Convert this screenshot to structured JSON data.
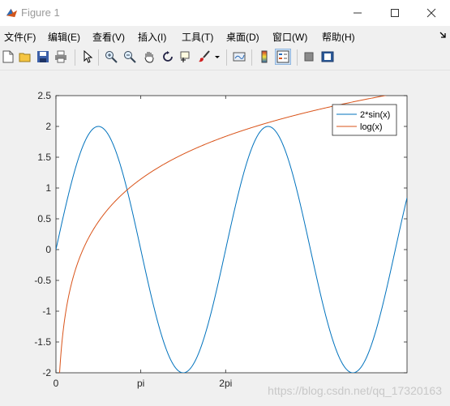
{
  "window": {
    "title": "Figure 1"
  },
  "menu": [
    "文件(F)",
    "编辑(E)",
    "查看(V)",
    "插入(I)",
    "工具(T)",
    "桌面(D)",
    "窗口(W)",
    "帮助(H)"
  ],
  "toolbar": {
    "icons": [
      "new-figure-icon",
      "open-file-icon",
      "save-icon",
      "print-icon",
      "edit-plot-arrow-icon",
      "zoom-in-icon",
      "zoom-out-icon",
      "pan-hand-icon",
      "rotate-3d-icon",
      "data-cursor-icon",
      "brush-icon",
      "brush-dropdown-icon",
      "link-plot-icon",
      "colorbar-icon",
      "legend-icon",
      "hide-plot-tools-icon",
      "show-plot-tools-icon"
    ]
  },
  "chart_data": {
    "type": "line",
    "x_range": [
      0,
      13.0
    ],
    "xticks": [
      {
        "value": 0,
        "label": "0"
      },
      {
        "value": 3.14159,
        "label": "pi"
      },
      {
        "value": 6.28319,
        "label": "2pi"
      }
    ],
    "ylim": [
      -2,
      2.5
    ],
    "yticks": [
      "-2",
      "-1.5",
      "-1",
      "-0.5",
      "0",
      "0.5",
      "1",
      "1.5",
      "2",
      "2.5"
    ],
    "series": [
      {
        "name": "2*sin(x)",
        "expr": "2*sin(x)",
        "color": "#0072bd"
      },
      {
        "name": "log(x)",
        "expr": "log(x)",
        "color": "#d95319"
      }
    ],
    "legend_position": "top-right"
  },
  "watermark": "https://blog.csdn.net/qq_17320163"
}
